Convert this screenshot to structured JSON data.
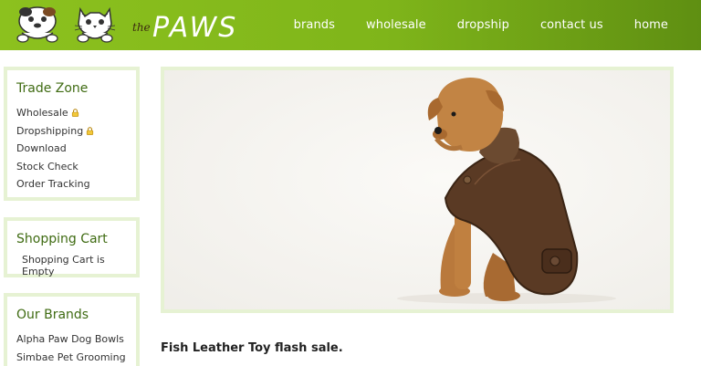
{
  "header": {
    "logo_text": "the PAWS",
    "nav": [
      "brands",
      "wholesale",
      "dropship",
      "contact us",
      "home"
    ]
  },
  "sidebar": {
    "trade_zone": {
      "title": "Trade Zone",
      "items": [
        "Wholesale",
        "Dropshipping",
        "Download",
        "Stock Check",
        "Order Tracking"
      ]
    },
    "cart": {
      "title": "Shopping Cart",
      "status": "Shopping Cart is Empty"
    },
    "brands": {
      "title": "Our Brands",
      "items": [
        "Alpha Paw Dog Bowls",
        "Simbae Pet Grooming"
      ]
    }
  },
  "main": {
    "headline": "Fish Leather Toy flash sale."
  },
  "colors": {
    "header_green": "#7fb51a",
    "box_border": "#e6f2d3",
    "heading_green": "#3f6b12"
  }
}
